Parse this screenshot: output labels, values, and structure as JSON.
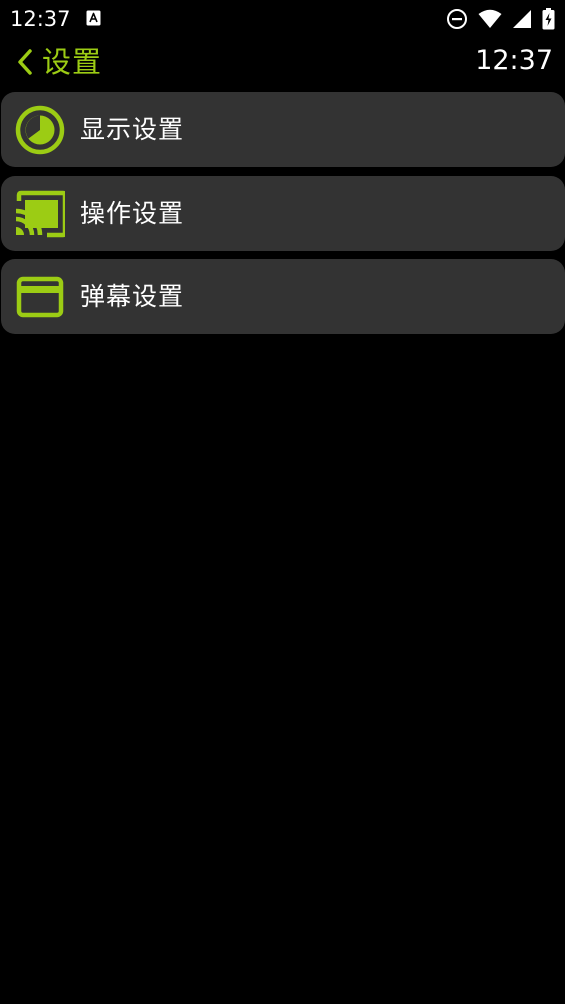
{
  "status_bar": {
    "time": "12:37",
    "icons": [
      "a-notification-icon",
      "do-not-disturb-icon",
      "wifi-icon",
      "cell-signal-icon",
      "battery-charging-icon"
    ]
  },
  "header": {
    "title": "设置",
    "clock": "12:37"
  },
  "menu": {
    "items": [
      {
        "label": "显示设置",
        "icon": "display-icon"
      },
      {
        "label": "操作设置",
        "icon": "cast-icon"
      },
      {
        "label": "弹幕设置",
        "icon": "danmaku-card-icon"
      }
    ]
  },
  "colors": {
    "accent": "#9ccc14",
    "background": "#000000",
    "item_background": "#333333",
    "text": "#ffffff"
  }
}
